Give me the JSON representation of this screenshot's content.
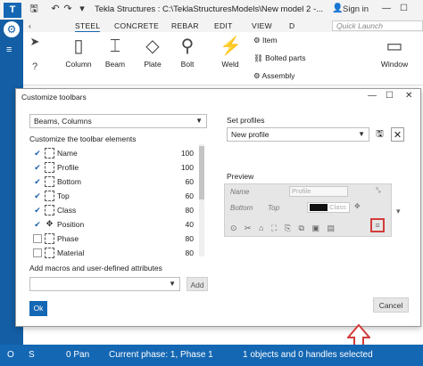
{
  "titlebar": {
    "logo": "T",
    "title": "Tekla Structures : C:\\TeklaStructuresModels\\New model 2  -...",
    "sign_in": "Sign in"
  },
  "tabs": [
    "STEEL",
    "CONCRETE",
    "REBAR",
    "EDIT",
    "VIEW",
    "D"
  ],
  "quick_launch": {
    "placeholder": "Quick Launch"
  },
  "ribbon": {
    "column": "Column",
    "beam": "Beam",
    "plate": "Plate",
    "bolt": "Bolt",
    "weld": "Weld",
    "item": "Item",
    "bolted_parts": "Bolted parts",
    "assembly": "Assembly",
    "window": "Window"
  },
  "dialog": {
    "title": "Customize toolbars",
    "toolbar_select": "Beams, Columns",
    "customize_label": "Customize the toolbar elements",
    "set_profiles_label": "Set profiles",
    "profile_select": "New profile",
    "preview_label": "Preview",
    "macros_label": "Add macros and user-defined attributes",
    "add_button": "Add",
    "ok_button": "Ok",
    "cancel_button": "Cancel",
    "elements": [
      {
        "name": "Name",
        "value": "100",
        "checked": true
      },
      {
        "name": "Profile",
        "value": "100",
        "checked": true
      },
      {
        "name": "Bottom",
        "value": "60",
        "checked": true
      },
      {
        "name": "Top",
        "value": "60",
        "checked": true
      },
      {
        "name": "Class",
        "value": "80",
        "checked": true
      },
      {
        "name": "Position",
        "value": "40",
        "checked": true
      },
      {
        "name": "Phase",
        "value": "80",
        "checked": false
      },
      {
        "name": "Material",
        "value": "80",
        "checked": false
      }
    ],
    "preview": {
      "name": "Name",
      "profile": "Profile",
      "bottom": "Bottom",
      "top": "Top",
      "class": "Class"
    }
  },
  "statusbar": {
    "left_o": "O",
    "left_s": "S",
    "pan": "0 Pan",
    "phase": "Current phase: 1, Phase 1",
    "selection": "1 objects and 0 handles selected"
  },
  "colors": {
    "accent": "#1467b3",
    "highlight": "#d23b3b"
  }
}
